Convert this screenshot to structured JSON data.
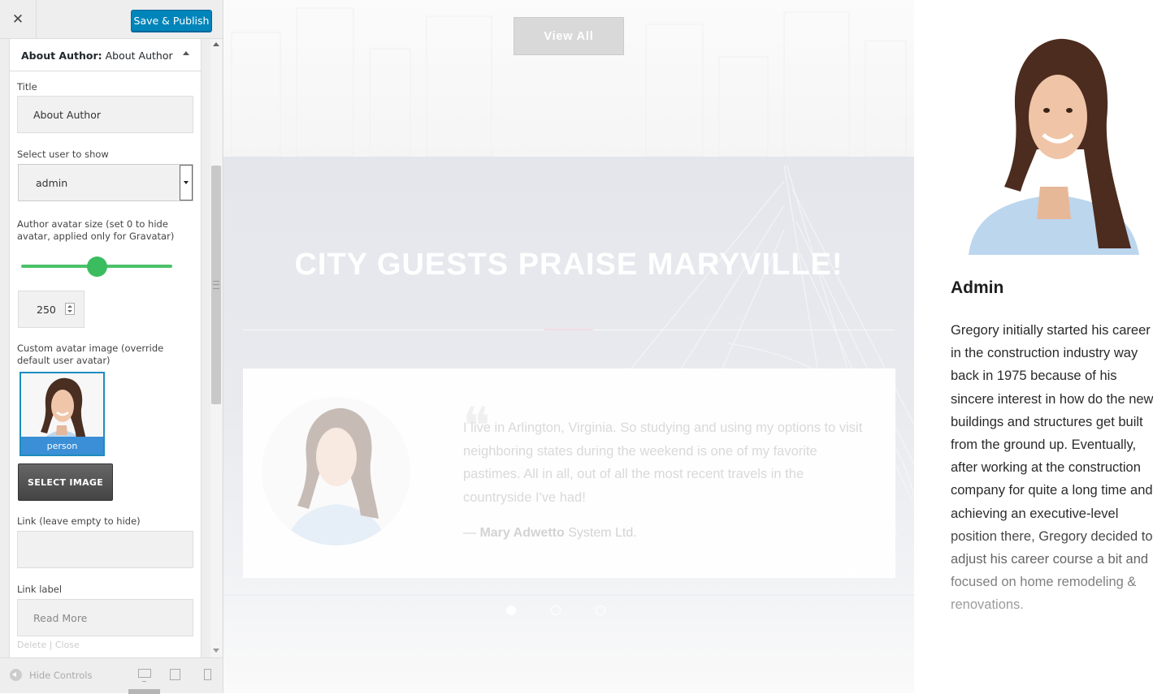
{
  "toolbar": {
    "close_glyph": "✕",
    "publish_label": "Save & Publish"
  },
  "widget": {
    "header_prefix": "About Author:",
    "header_name": "About Author",
    "title_label": "Title",
    "title_value": "About Author",
    "user_label": "Select user to show",
    "user_value": "admin",
    "avatar_size_label": "Author avatar size (set 0 to hide avatar, applied only for Gravatar)",
    "avatar_size_value": "250",
    "avatar_size_slider_fraction": 0.5,
    "custom_avatar_label": "Custom avatar image (override default user avatar)",
    "avatar_caption": "person",
    "select_image_label": "SELECT IMAGE",
    "link_label": "Link (leave empty to hide)",
    "link_value": "",
    "link_text_label": "Link label",
    "link_text_value": "Read More",
    "delete_close": "Delete | Close"
  },
  "footer": {
    "hide_controls": "Hide Controls"
  },
  "preview": {
    "view_all": "View All",
    "section_title": "CITY GUESTS PRAISE MARYVILLE!",
    "testimonial": {
      "text": "I live in Arlington, Virginia. So studying and using my options to visit neighboring states during the weekend is one of my favorite pastimes. All in all, out of all the most recent travels in the countryside I've had!",
      "author_prefix": "— ",
      "author_name": "Mary Adwetto",
      "author_company": " System Ltd."
    },
    "author": {
      "name": "Admin",
      "bio": "Gregory initially started his career in the construction industry way back in 1975 because of his sincere interest in how do the new buildings and structures get built from the ground up. Eventually, after working at the construction company for quite a long time and achieving an executive-level position there, Gregory decided to adjust his career course a bit and focused on home remodeling & renovations."
    }
  },
  "colors": {
    "publish": "#0085ba",
    "slider": "#3bbd5f",
    "selected_border": "#1e8cbe"
  }
}
